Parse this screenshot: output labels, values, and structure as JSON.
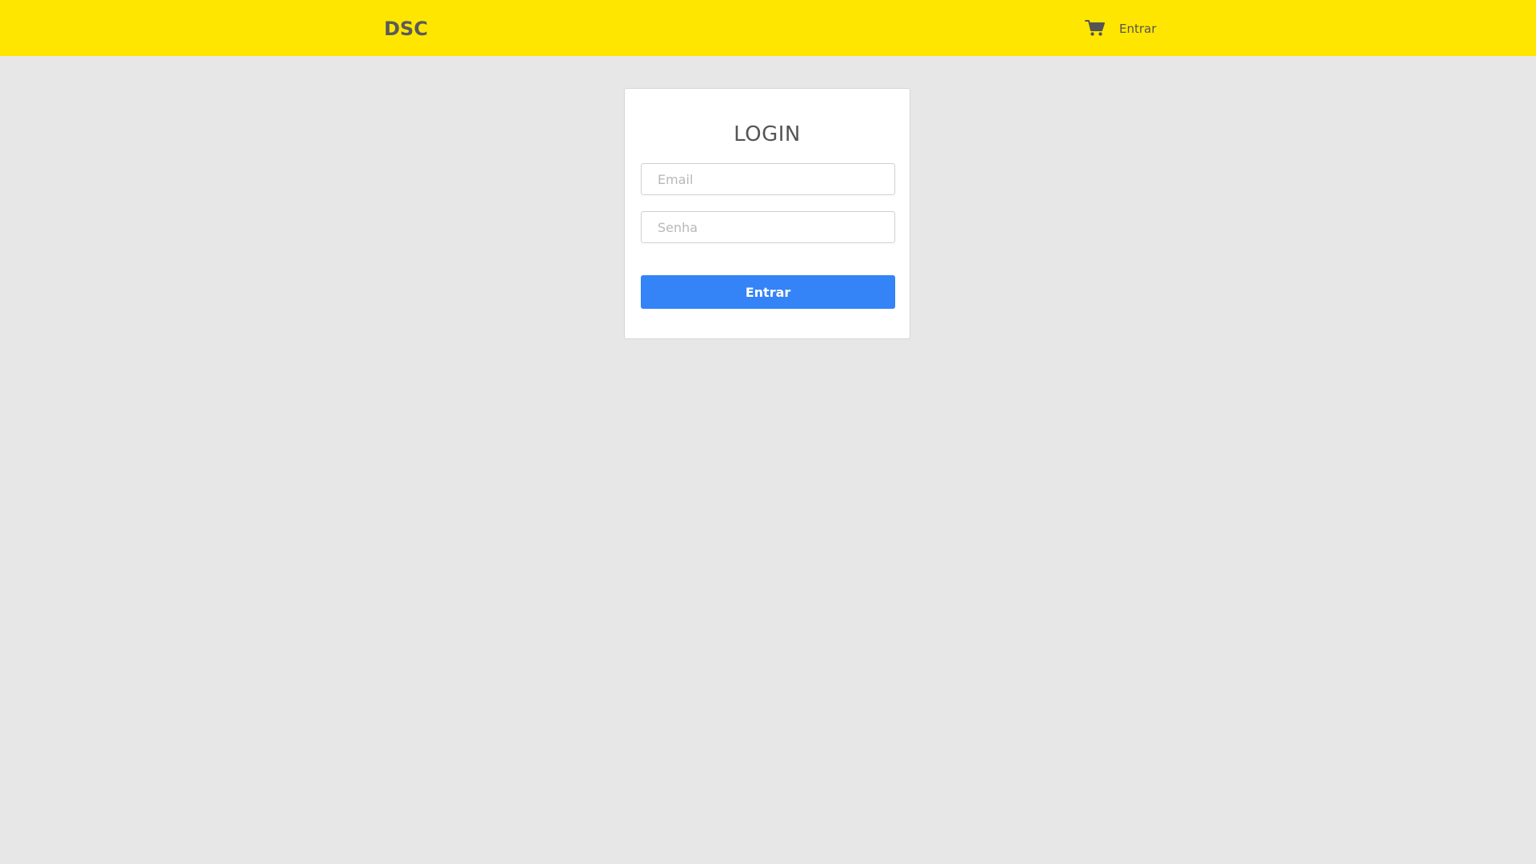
{
  "navbar": {
    "brand": "DSC",
    "cart_icon": "shopping-cart-icon",
    "login_link": "Entrar",
    "background_color": "#ffe600"
  },
  "login_card": {
    "title": "LOGIN",
    "email": {
      "placeholder": "Email",
      "value": ""
    },
    "password": {
      "placeholder": "Senha",
      "value": ""
    },
    "submit_label": "Entrar",
    "submit_color": "#3483f7"
  }
}
